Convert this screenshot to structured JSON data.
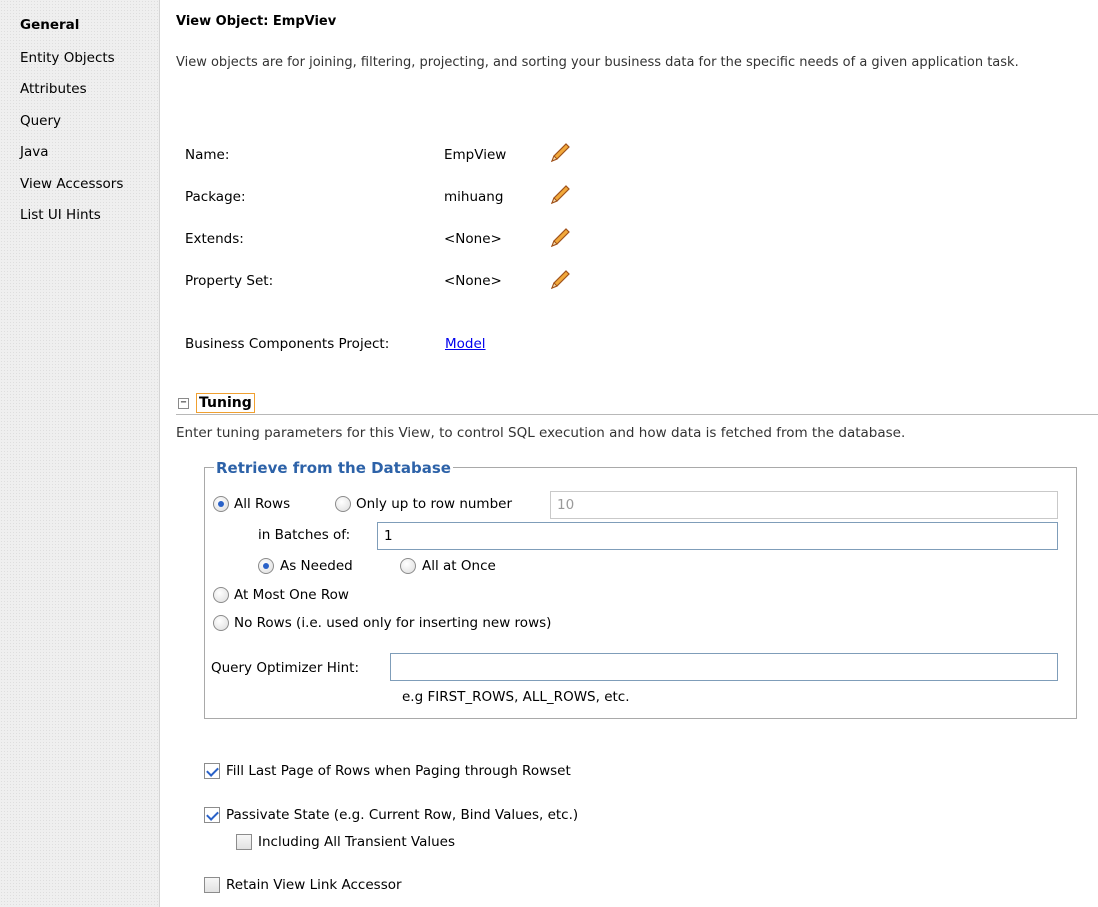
{
  "sidebar": {
    "items": [
      {
        "label": "General"
      },
      {
        "label": "Entity Objects"
      },
      {
        "label": "Attributes"
      },
      {
        "label": "Query"
      },
      {
        "label": "Java"
      },
      {
        "label": "View Accessors"
      },
      {
        "label": "List UI Hints"
      }
    ],
    "active_index": 0
  },
  "header": {
    "title": "View Object: EmpViev",
    "description": "View objects are for joining, filtering, projecting, and sorting your business data for the specific needs of a given application task."
  },
  "properties": {
    "name_label": "Name:",
    "name_value": "EmpView",
    "package_label": "Package:",
    "package_value": "mihuang",
    "extends_label": "Extends:",
    "extends_value": "<None>",
    "property_set_label": "Property Set:",
    "property_set_value": "<None>",
    "project_label": "Business Components Project:",
    "project_link": "Model",
    "edit_icon": "pencil-icon"
  },
  "tuning": {
    "toggle_symbol": "−",
    "title": "Tuning",
    "description": "Enter tuning parameters for this View, to control SQL execution and how data is fetched from the database.",
    "retrieve": {
      "legend": "Retrieve from the Database",
      "all_rows_label": "All Rows",
      "only_up_to_label": "Only up to row number",
      "only_up_to_value": "10",
      "batches_label": "in Batches of:",
      "batches_value": "1",
      "as_needed_label": "As Needed",
      "all_at_once_label": "All at Once",
      "at_most_one_label": "At Most One Row",
      "no_rows_label": "No Rows (i.e. used only for inserting new rows)",
      "hint_label": "Query Optimizer Hint:",
      "hint_value": "",
      "hint_example": "e.g FIRST_ROWS, ALL_ROWS, etc.",
      "selected_mode": "All Rows",
      "selected_fetch": "As Needed"
    },
    "options": {
      "fill_last_page_label": "Fill Last Page of Rows when Paging through Rowset",
      "fill_last_page_checked": true,
      "passivate_label": "Passivate State (e.g. Current Row, Bind Values, etc.)",
      "passivate_checked": true,
      "transient_label": "Including All Transient Values",
      "transient_checked": false,
      "retain_label": "Retain View Link Accessor",
      "retain_checked": false
    }
  },
  "colors": {
    "legend": "#2d62a8",
    "link": "#0000ee",
    "check": "#2a62c8",
    "tuning_focus_border": "#f0a030"
  }
}
